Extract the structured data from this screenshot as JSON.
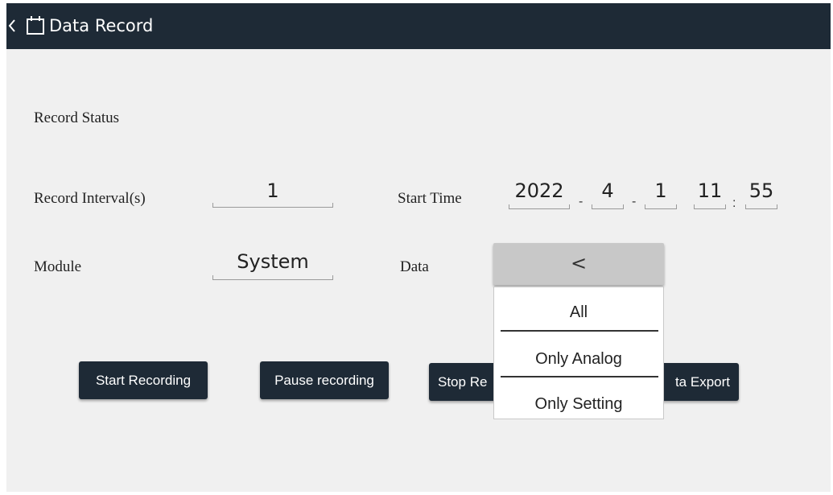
{
  "header": {
    "title": "Data Record",
    "back_icon": "chevron-left-icon",
    "title_icon": "calendar-icon"
  },
  "labels": {
    "record_status": "Record Status",
    "record_interval": "Record Interval(s)",
    "start_time": "Start Time",
    "module": "Module",
    "data": "Data"
  },
  "fields": {
    "record_interval": "1",
    "start_year": "2022",
    "start_month": "4",
    "start_day": "1",
    "start_hour": "11",
    "start_minute": "55",
    "module": "System",
    "date_sep": "-",
    "time_sep": ":"
  },
  "buttons": {
    "start": "Start Recording",
    "pause": "Pause recording",
    "stop": "Stop Re",
    "export": "ta Export"
  },
  "dropdown": {
    "toggle": "<",
    "options": [
      "All",
      "Only Analog",
      "Only Setting"
    ]
  },
  "colors": {
    "titlebar": "#1e2a36",
    "button": "#1e2a36",
    "background": "#f0f0f0"
  }
}
